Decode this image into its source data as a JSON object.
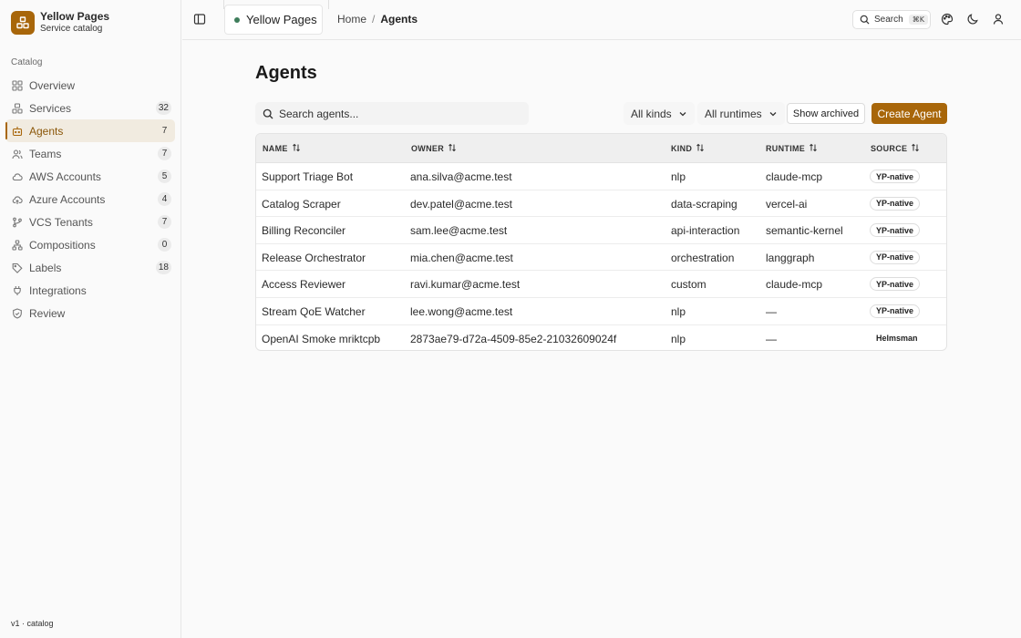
{
  "app": {
    "title": "Yellow Pages",
    "subtitle": "Service catalog",
    "version": "v1 · catalog",
    "accent_color": "#a8660a"
  },
  "sidebar": {
    "section_label": "Catalog",
    "items": [
      {
        "label": "Overview",
        "icon": "grid-icon",
        "count": ""
      },
      {
        "label": "Services",
        "icon": "services-icon",
        "count": "32"
      },
      {
        "label": "Agents",
        "icon": "bot-icon",
        "count": "7",
        "active": true
      },
      {
        "label": "Teams",
        "icon": "users-icon",
        "count": "7"
      },
      {
        "label": "AWS Accounts",
        "icon": "cloud-icon",
        "count": "5"
      },
      {
        "label": "Azure Accounts",
        "icon": "cloud-upload-icon",
        "count": "4"
      },
      {
        "label": "VCS Tenants",
        "icon": "git-branch-icon",
        "count": "7"
      },
      {
        "label": "Compositions",
        "icon": "network-icon",
        "count": "0"
      },
      {
        "label": "Labels",
        "icon": "tag-icon",
        "count": "18"
      },
      {
        "label": "Integrations",
        "icon": "plug-icon",
        "count": ""
      },
      {
        "label": "Review",
        "icon": "shield-check-icon",
        "count": ""
      }
    ]
  },
  "header": {
    "workspace": "Yellow Pages",
    "breadcrumb": {
      "home": "Home",
      "separator": "/",
      "current": "Agents"
    },
    "search_label": "Search",
    "search_shortcut": "⌘K"
  },
  "main": {
    "title": "Agents",
    "search_placeholder": "Search agents...",
    "filters": {
      "kinds": "All kinds",
      "runtimes": "All runtimes"
    },
    "show_archived_label": "Show archived",
    "create_label": "Create Agent"
  },
  "table": {
    "columns": [
      "NAME",
      "OWNER",
      "KIND",
      "RUNTIME",
      "SOURCE"
    ],
    "rows": [
      {
        "name": "Support Triage Bot",
        "owner": "ana.silva@acme.test",
        "kind": "nlp",
        "runtime": "claude-mcp",
        "source": "YP-native"
      },
      {
        "name": "Catalog Scraper",
        "owner": "dev.patel@acme.test",
        "kind": "data-scraping",
        "runtime": "vercel-ai",
        "source": "YP-native"
      },
      {
        "name": "Billing Reconciler",
        "owner": "sam.lee@acme.test",
        "kind": "api-interaction",
        "runtime": "semantic-kernel",
        "source": "YP-native"
      },
      {
        "name": "Release Orchestrator",
        "owner": "mia.chen@acme.test",
        "kind": "orchestration",
        "runtime": "langgraph",
        "source": "YP-native"
      },
      {
        "name": "Access Reviewer",
        "owner": "ravi.kumar@acme.test",
        "kind": "custom",
        "runtime": "claude-mcp",
        "source": "YP-native"
      },
      {
        "name": "Stream QoE Watcher",
        "owner": "lee.wong@acme.test",
        "kind": "nlp",
        "runtime": "—",
        "source": "YP-native"
      },
      {
        "name": "OpenAI Smoke mriktcpb",
        "owner": "2873ae79-d72a-4509-85e2-21032609024f",
        "kind": "nlp",
        "runtime": "—",
        "source": "Helmsman"
      }
    ]
  }
}
